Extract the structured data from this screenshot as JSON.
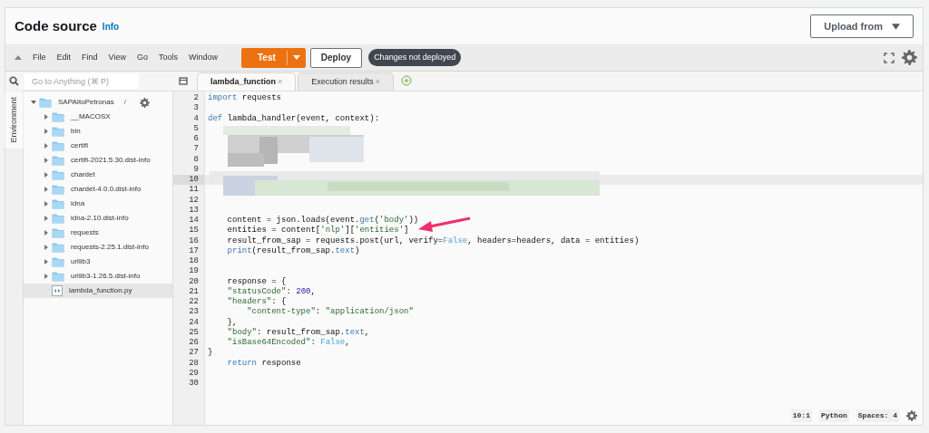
{
  "header": {
    "title": "Code source",
    "info_link": "Info",
    "upload_button": "Upload from"
  },
  "menu": [
    "File",
    "Edit",
    "Find",
    "View",
    "Go",
    "Tools",
    "Window"
  ],
  "toolbar": {
    "test_button": "Test",
    "deploy_button": "Deploy",
    "status_badge": "Changes not deployed"
  },
  "search": {
    "placeholder": "Go to Anything (⌘ P)"
  },
  "side_tab": {
    "label": "Environment",
    "selected": true
  },
  "tree": [
    {
      "label": "SAPAItoPetronas",
      "suffix": "/",
      "kind": "folder",
      "expanded": true,
      "selected": false,
      "children": [
        {
          "label": "__MACOSX",
          "kind": "folder",
          "expanded": false,
          "selected": false
        },
        {
          "label": "bin",
          "kind": "folder",
          "expanded": false,
          "selected": false
        },
        {
          "label": "certifi",
          "kind": "folder",
          "expanded": false,
          "selected": false
        },
        {
          "label": "certifi-2021.5.30.dist-info",
          "kind": "folder",
          "expanded": false,
          "selected": false
        },
        {
          "label": "chardet",
          "kind": "folder",
          "expanded": false,
          "selected": false
        },
        {
          "label": "chardet-4.0.0.dist-info",
          "kind": "folder",
          "expanded": false,
          "selected": false
        },
        {
          "label": "idna",
          "kind": "folder",
          "expanded": false,
          "selected": false
        },
        {
          "label": "idna-2.10.dist-info",
          "kind": "folder",
          "expanded": false,
          "selected": false
        },
        {
          "label": "requests",
          "kind": "folder",
          "expanded": false,
          "selected": false
        },
        {
          "label": "requests-2.25.1.dist-info",
          "kind": "folder",
          "expanded": false,
          "selected": false
        },
        {
          "label": "urllib3",
          "kind": "folder",
          "expanded": false,
          "selected": false
        },
        {
          "label": "urllib3-1.26.5.dist-info",
          "kind": "folder",
          "expanded": false,
          "selected": false
        },
        {
          "label": "lambda_function.py",
          "kind": "file",
          "selected": true
        }
      ]
    }
  ],
  "tabs": [
    {
      "label": "lambda_function",
      "close": "×",
      "selected": true
    },
    {
      "label": "Execution results",
      "close": "×",
      "selected": false
    }
  ],
  "code_lines": [
    {
      "number": "2",
      "current": false,
      "segments": [
        {
          "kind": "keyword",
          "text": "import"
        },
        {
          "kind": "plain",
          "text": " requests"
        }
      ]
    },
    {
      "number": "3",
      "current": false
    },
    {
      "number": "4",
      "current": false,
      "segments": [
        {
          "kind": "keyword",
          "text": "def"
        },
        {
          "kind": "plain",
          "text": " lambda_handler(event, context):"
        }
      ]
    },
    {
      "number": "5",
      "current": false
    },
    {
      "number": "6",
      "current": false
    },
    {
      "number": "7",
      "current": false
    },
    {
      "number": "8",
      "current": false
    },
    {
      "number": "9",
      "current": false
    },
    {
      "number": "10",
      "current": true
    },
    {
      "number": "11",
      "current": false
    },
    {
      "number": "12",
      "current": false
    },
    {
      "number": "13",
      "current": false
    },
    {
      "number": "14",
      "current": false,
      "segments": [
        {
          "kind": "plain",
          "text": "    content = json.loads(event."
        },
        {
          "kind": "method",
          "text": "get"
        },
        {
          "kind": "plain",
          "text": "("
        },
        {
          "kind": "string",
          "text": "'body'"
        },
        {
          "kind": "plain",
          "text": "))"
        }
      ]
    },
    {
      "number": "15",
      "current": false,
      "segments": [
        {
          "kind": "plain",
          "text": "    entities = content["
        },
        {
          "kind": "string",
          "text": "'nlp'"
        },
        {
          "kind": "plain",
          "text": "]["
        },
        {
          "kind": "string",
          "text": "'entities'"
        },
        {
          "kind": "plain",
          "text": "]"
        }
      ]
    },
    {
      "number": "16",
      "current": false,
      "segments": [
        {
          "kind": "plain",
          "text": "    result_from_sap = requests.post(url, verify="
        },
        {
          "kind": "constant",
          "text": "False"
        },
        {
          "kind": "plain",
          "text": ", headers=headers, data = entities)"
        }
      ]
    },
    {
      "number": "17",
      "current": false,
      "segments": [
        {
          "kind": "method",
          "text": "    print"
        },
        {
          "kind": "plain",
          "text": "(result_from_sap."
        },
        {
          "kind": "method",
          "text": "text"
        },
        {
          "kind": "plain",
          "text": ")"
        }
      ]
    },
    {
      "number": "18",
      "current": false
    },
    {
      "number": "19",
      "current": false
    },
    {
      "number": "20",
      "current": false,
      "segments": [
        {
          "kind": "plain",
          "text": "    response = {"
        }
      ]
    },
    {
      "number": "21",
      "current": false,
      "segments": [
        {
          "kind": "string",
          "text": "    \"statusCode\""
        },
        {
          "kind": "plain",
          "text": ": "
        },
        {
          "kind": "number",
          "text": "200"
        },
        {
          "kind": "plain",
          "text": ","
        }
      ]
    },
    {
      "number": "22",
      "current": false,
      "segments": [
        {
          "kind": "string",
          "text": "    \"headers\""
        },
        {
          "kind": "plain",
          "text": ": {"
        }
      ]
    },
    {
      "number": "23",
      "current": false,
      "segments": [
        {
          "kind": "string",
          "text": "        \"content-type\""
        },
        {
          "kind": "plain",
          "text": ": "
        },
        {
          "kind": "string",
          "text": "\"application/json\""
        }
      ]
    },
    {
      "number": "24",
      "current": false,
      "segments": [
        {
          "kind": "plain",
          "text": "    },"
        }
      ]
    },
    {
      "number": "25",
      "current": false,
      "segments": [
        {
          "kind": "string",
          "text": "    \"body\""
        },
        {
          "kind": "plain",
          "text": ": result_from_sap."
        },
        {
          "kind": "method",
          "text": "text"
        },
        {
          "kind": "plain",
          "text": ","
        }
      ]
    },
    {
      "number": "26",
      "current": false,
      "segments": [
        {
          "kind": "string",
          "text": "    \"isBase64Encoded\""
        },
        {
          "kind": "plain",
          "text": ": "
        },
        {
          "kind": "constant",
          "text": "False"
        },
        {
          "kind": "plain",
          "text": ","
        }
      ]
    },
    {
      "number": "27",
      "current": false,
      "segments": [
        {
          "kind": "plain",
          "text": "}"
        }
      ]
    },
    {
      "number": "28",
      "current": false,
      "segments": [
        {
          "kind": "keyword",
          "text": "    return"
        },
        {
          "kind": "plain",
          "text": " response"
        }
      ]
    },
    {
      "number": "29",
      "current": false
    },
    {
      "number": "30",
      "current": false
    }
  ],
  "status_bar": {
    "cursor": "10:1",
    "language": "Python",
    "indent": "Spaces: 4"
  }
}
